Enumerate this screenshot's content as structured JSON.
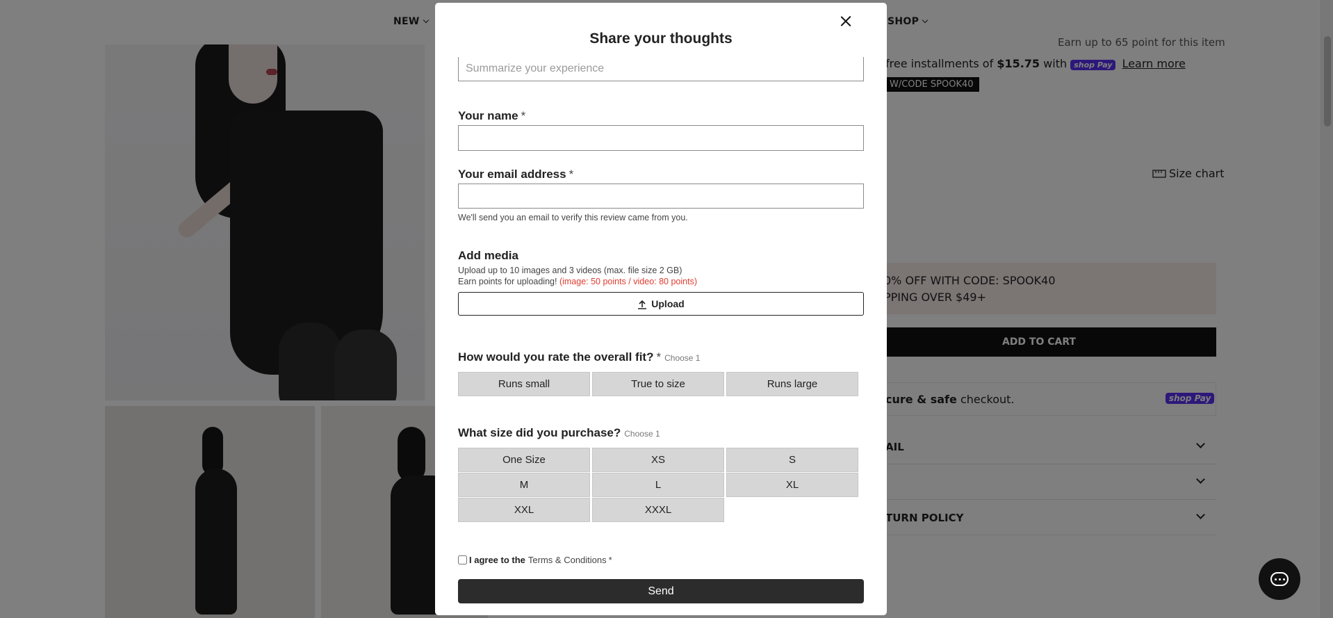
{
  "nav": {
    "items": [
      {
        "label": "NEW"
      },
      {
        "label": "SHOP"
      }
    ]
  },
  "product": {
    "points_text": "Earn up to 65 point for this item",
    "installments_prefix": "free installments of",
    "installments_amount": "$15.75",
    "installments_with": "with",
    "shoppay_label": "shop Pay",
    "learn_more": "Learn more",
    "code_badge": "W/CODE SPOOK40",
    "size_chart": "Size chart",
    "promo_line1": "0% OFF WITH CODE: SPOOK40",
    "promo_line2": "PPING OVER $49+",
    "add_to_cart": "ADD TO CART",
    "secure_bold": "cure & safe",
    "secure_rest": "checkout.",
    "accordions": [
      {
        "label": "AIL"
      },
      {
        "label": ""
      },
      {
        "label": "TURN POLICY"
      }
    ]
  },
  "modal": {
    "title": "Share your thoughts",
    "summary_placeholder": "Summarize your experience",
    "name_label": "Your name",
    "email_label": "Your email address",
    "required_mark": "*",
    "email_note": "We'll send you an email to verify this review came from you.",
    "media_label": "Add media",
    "media_note1": "Upload up to 10 images and 3 videos (max. file size 2 GB)",
    "media_note2_prefix": "Earn points for uploading!",
    "media_note2_red": "(image: 50 points / video: 80 points)",
    "upload_label": "Upload",
    "fit_label": "How would you rate the overall fit?",
    "choose_one": "Choose 1",
    "fit_options": [
      "Runs small",
      "True to size",
      "Runs large"
    ],
    "size_label": "What size did you purchase?",
    "size_options": [
      "One Size",
      "XS",
      "S",
      "M",
      "L",
      "XL",
      "XXL",
      "XXXL"
    ],
    "agree_prefix": "I agree to the",
    "agree_link": "Terms & Conditions",
    "send_label": "Send"
  }
}
